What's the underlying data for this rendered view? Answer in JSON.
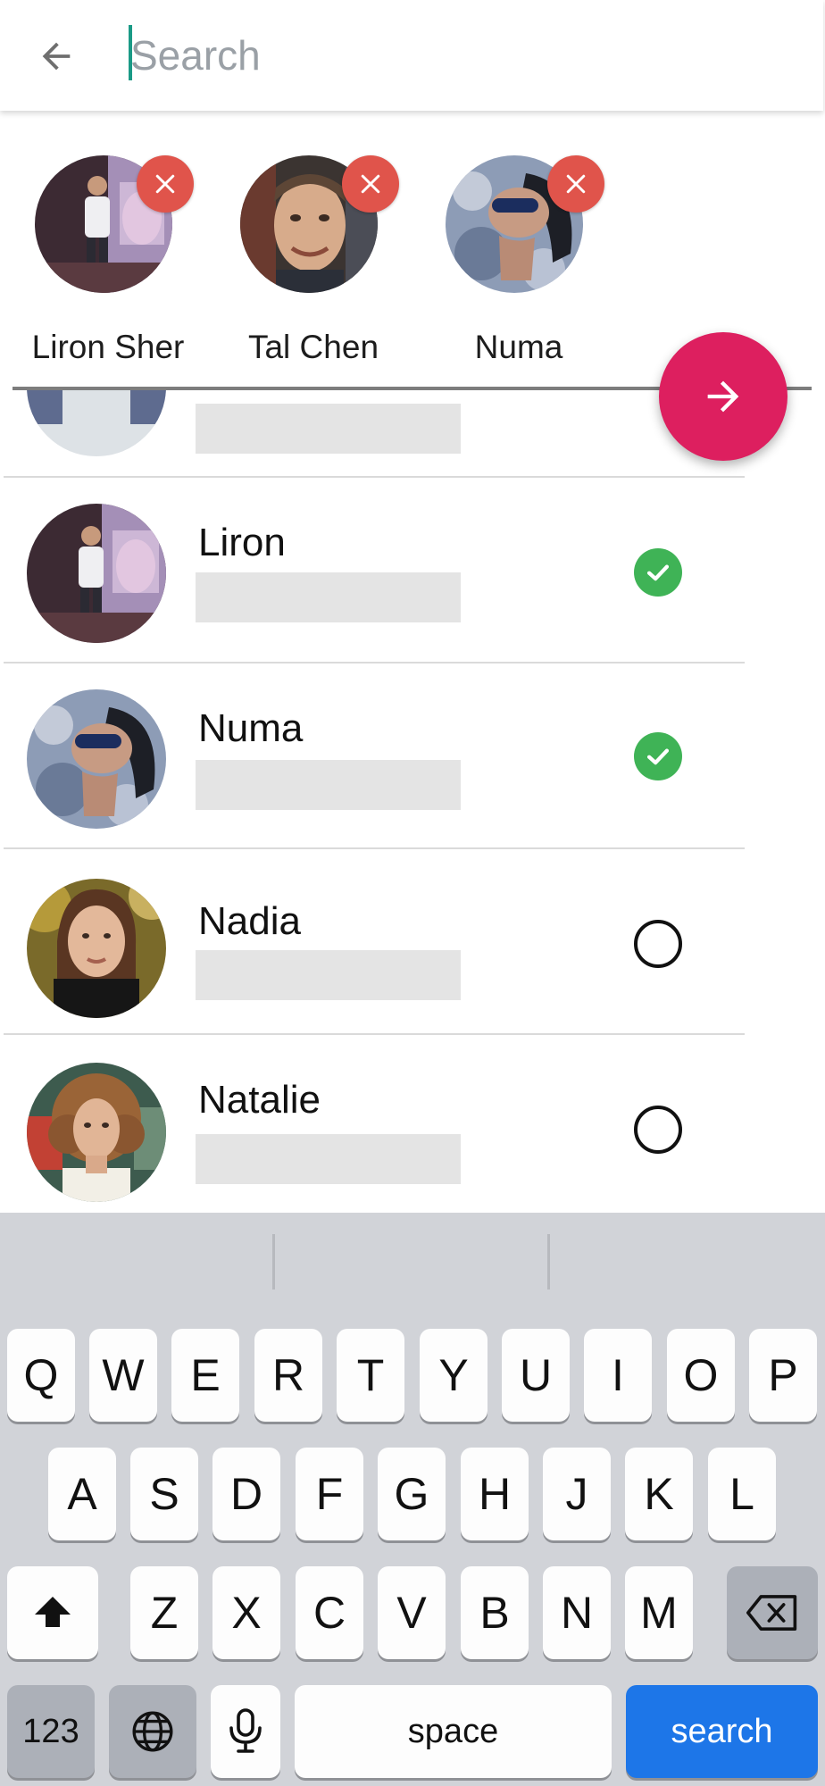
{
  "header": {
    "search_placeholder": "Search",
    "back_icon": "arrow-left-icon"
  },
  "selected": [
    {
      "name": "Liron Sher",
      "avatar_color": "#5b3f4c"
    },
    {
      "name": "Tal Chen",
      "avatar_color": "#8a6b55"
    },
    {
      "name": "Numa",
      "avatar_color": "#5f6e8a"
    }
  ],
  "contacts": [
    {
      "name": "",
      "selected": null
    },
    {
      "name": "Liron",
      "selected": true
    },
    {
      "name": "Numa",
      "selected": true
    },
    {
      "name": "Nadia",
      "selected": false
    },
    {
      "name": "Natalie",
      "selected": false
    }
  ],
  "colors": {
    "accent": "#dd1f5f",
    "remove": "#e0544b",
    "check": "#3fb356",
    "keyboard_action": "#1d76e8"
  },
  "keyboard": {
    "row1": [
      "Q",
      "W",
      "E",
      "R",
      "T",
      "Y",
      "U",
      "I",
      "O",
      "P"
    ],
    "row2": [
      "A",
      "S",
      "D",
      "F",
      "G",
      "H",
      "J",
      "K",
      "L"
    ],
    "row3": [
      "Z",
      "X",
      "C",
      "V",
      "B",
      "N",
      "M"
    ],
    "numbers_label": "123",
    "space_label": "space",
    "action_label": "search"
  }
}
